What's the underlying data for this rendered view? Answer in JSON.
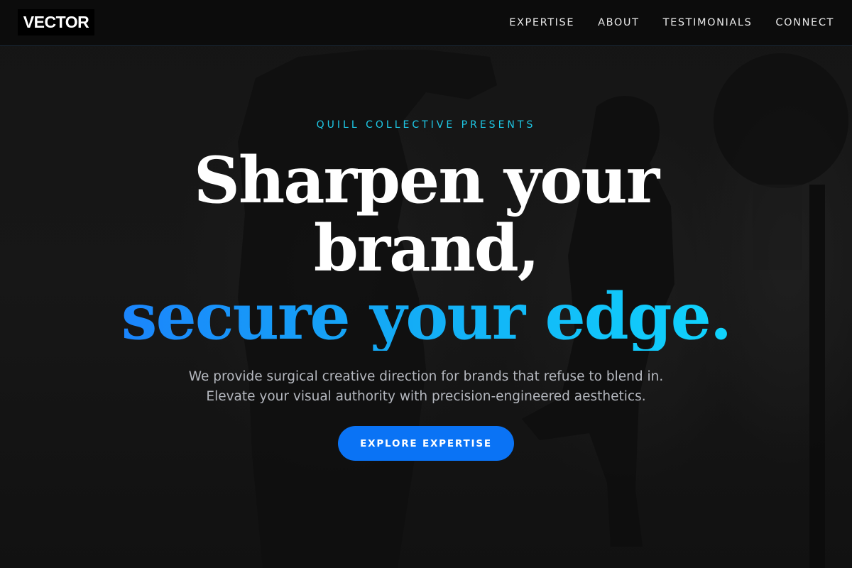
{
  "brand": {
    "logo_text": "VECTOR"
  },
  "nav": {
    "links": [
      "EXPERTISE",
      "ABOUT",
      "TESTIMONIALS",
      "CONNECT"
    ]
  },
  "hero": {
    "eyebrow": "QUILL COLLECTIVE PRESENTS",
    "headline_line1": "Sharpen your",
    "headline_line2": "brand,",
    "headline_accent": "secure your edge.",
    "subtitle": "We provide surgical creative direction for brands that refuse to blend in. Elevate your visual authority with precision-engineered aesthetics.",
    "cta_label": "EXPLORE EXPERTISE"
  },
  "colors": {
    "background": "#121212",
    "accent_blue": "#0a73f5",
    "accent_cyan": "#1ec8e6",
    "text_white": "#ffffff",
    "text_muted": "#b5b8bf"
  }
}
